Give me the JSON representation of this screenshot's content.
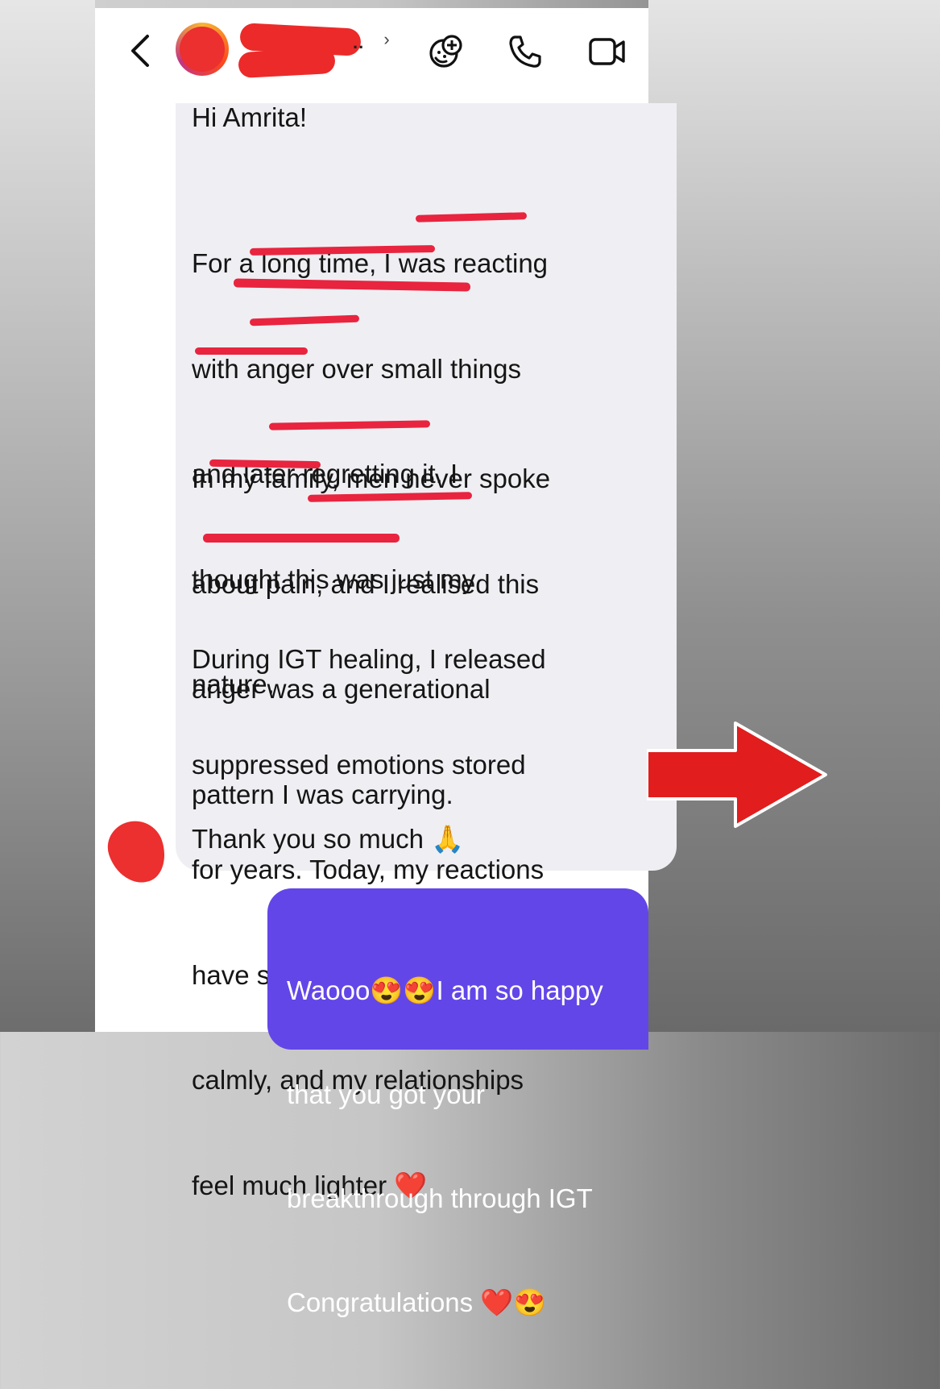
{
  "colors": {
    "incoming_bubble": "#efeff3",
    "outgoing_bubble": "#6346e8",
    "underline": "#e8243f",
    "redaction": "#ec2a2a",
    "arrow": "#e11d1d"
  },
  "header": {
    "title_overflow": "..",
    "chevron": "›",
    "icons": [
      "back-icon",
      "avatar",
      "sticker-icon",
      "call-icon",
      "video-icon"
    ]
  },
  "incoming": {
    "greeting": "Hi Amrita!",
    "p1": [
      "For a long time, I was reacting",
      "with anger over small things",
      "and later regretting it. I",
      "thought this was just my",
      "nature."
    ],
    "p2": [
      "In my family, men never spoke",
      "about pain, and I realised this",
      "anger was a generational",
      "pattern I was carrying."
    ],
    "p3": [
      "During IGT healing, I released",
      "suppressed emotions stored",
      "for years. Today, my reactions",
      "have softened, I respond",
      "calmly, and my relationships",
      "feel much lighter ❤️"
    ],
    "closing": "Thank you so much 🙏"
  },
  "outgoing": {
    "lines": [
      "Waooo😍😍I am so happy",
      "that you got your",
      "breakthrough through IGT",
      "Congratulations ❤️😍"
    ]
  }
}
